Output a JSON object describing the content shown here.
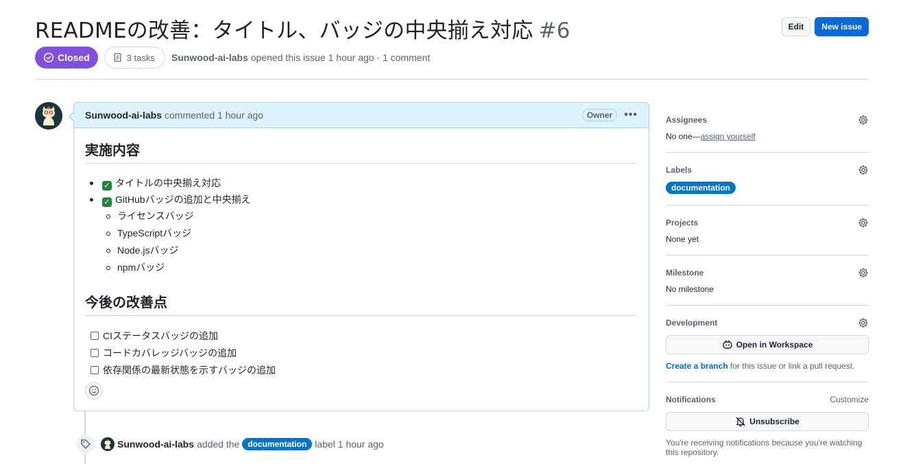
{
  "issue": {
    "title": "READMEの改善：タイトル、バッジの中央揃え対応",
    "number": "#6",
    "status": "Closed",
    "tasks": "3 tasks",
    "author": "Sunwood-ai-labs",
    "meta": "opened this issue 1 hour ago · 1 comment"
  },
  "toolbar": {
    "edit_label": "Edit",
    "new_issue_label": "New issue"
  },
  "comment": {
    "author": "Sunwood-ai-labs",
    "time": "commented 1 hour ago",
    "badge": "Owner",
    "heading1": "実施内容",
    "done": [
      "タイトルの中央揃え対応",
      "GitHubバッジの追加と中央揃え"
    ],
    "sub_items": [
      "ライセンスバッジ",
      "TypeScriptバッジ",
      "Node.jsバッジ",
      "npmバッジ"
    ],
    "heading2": "今後の改善点",
    "todo": [
      "CIステータスバッジの追加",
      "コードカバレッジバッジの追加",
      "依存関係の最新状態を示すバッジの追加"
    ]
  },
  "event": {
    "author": "Sunwood-ai-labs",
    "action": "added the",
    "label": "documentation",
    "suffix": "label 1 hour ago"
  },
  "sidebar": {
    "assignees": {
      "title": "Assignees",
      "none": "No one—",
      "link": "assign yourself"
    },
    "labels": {
      "title": "Labels",
      "label": "documentation"
    },
    "projects": {
      "title": "Projects",
      "value": "None yet"
    },
    "milestone": {
      "title": "Milestone",
      "value": "No milestone"
    },
    "development": {
      "title": "Development",
      "button": "Open in Workspace",
      "link": "Create a branch",
      "note": " for this issue or link a pull request."
    },
    "notifications": {
      "title": "Notifications",
      "customize": "Customize",
      "button": "Unsubscribe",
      "note": "You're receiving notifications because you're watching this repository."
    }
  },
  "colors": {
    "closed": "#8250df",
    "primary": "#0969da",
    "label": "#0075ca",
    "done_check": "#1f883d"
  }
}
